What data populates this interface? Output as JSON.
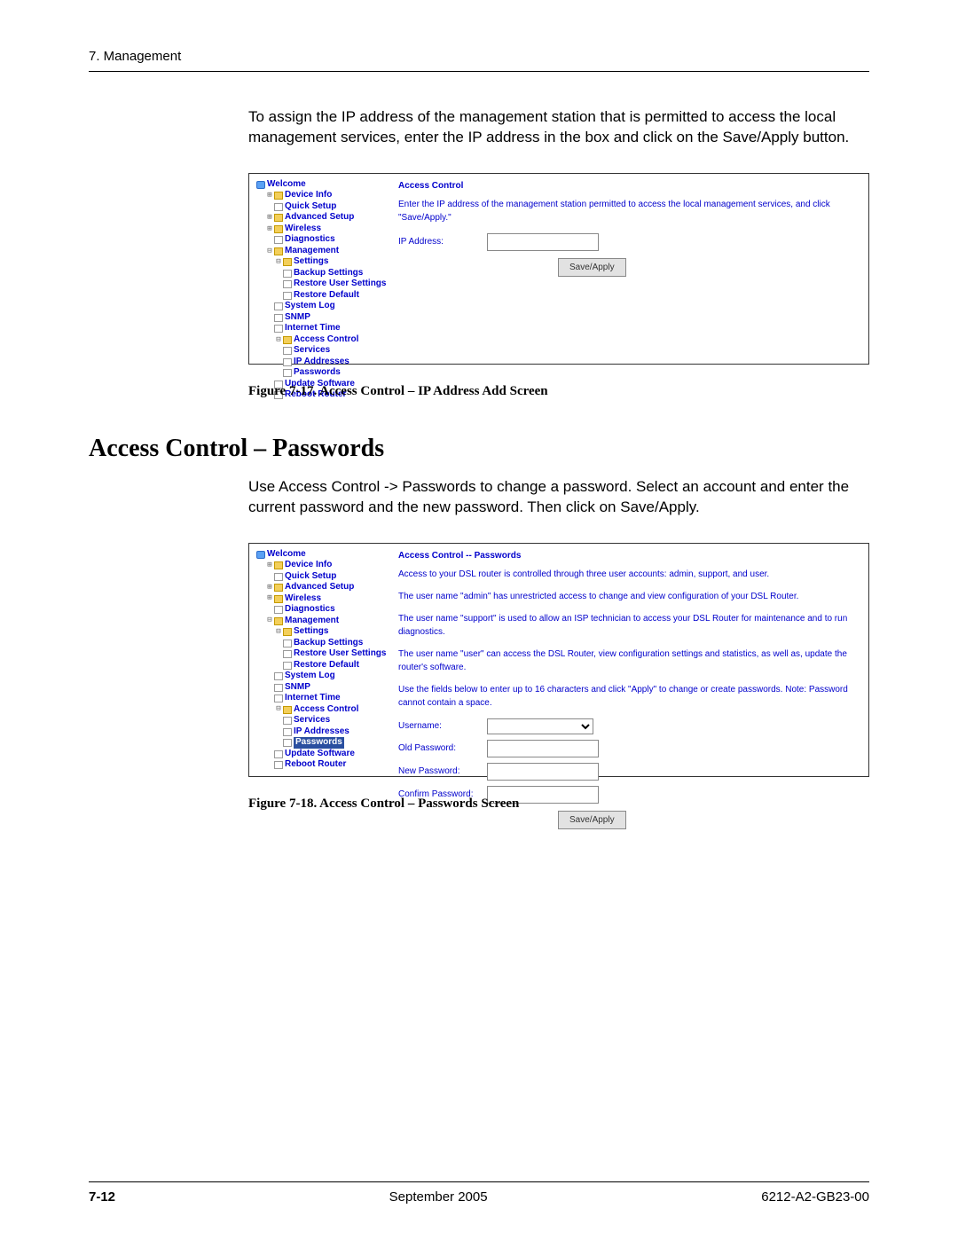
{
  "header": {
    "chapter": "7. Management"
  },
  "intro1": "To assign the IP address of the management station that is permitted to access the local management services, enter the IP address in the box and click on the Save/Apply button.",
  "fig17": {
    "nav": {
      "welcome": "Welcome",
      "device_info": "Device Info",
      "quick_setup": "Quick Setup",
      "advanced_setup": "Advanced Setup",
      "wireless": "Wireless",
      "diagnostics": "Diagnostics",
      "management": "Management",
      "settings": "Settings",
      "backup_settings": "Backup Settings",
      "restore_user": "Restore User Settings",
      "restore_default": "Restore Default",
      "system_log": "System Log",
      "snmp": "SNMP",
      "internet_time": "Internet Time",
      "access_control": "Access Control",
      "services": "Services",
      "ip_addresses": "IP Addresses",
      "passwords": "Passwords",
      "update_software": "Update Software",
      "reboot_router": "Reboot Router"
    },
    "content": {
      "title": "Access Control",
      "text": "Enter the IP address of the management station permitted to access the local management services, and click \"Save/Apply.\"",
      "ip_label": "IP Address:",
      "save": "Save/Apply"
    },
    "caption": "Figure 7-17.   Access Control – IP Address Add Screen"
  },
  "section2": {
    "heading": "Access Control – Passwords",
    "intro": "Use Access Control -> Passwords to change a password. Select an account and enter the current password and the new password. Then click on Save/Apply."
  },
  "fig18": {
    "nav": {
      "welcome": "Welcome",
      "device_info": "Device Info",
      "quick_setup": "Quick Setup",
      "advanced_setup": "Advanced Setup",
      "wireless": "Wireless",
      "diagnostics": "Diagnostics",
      "management": "Management",
      "settings": "Settings",
      "backup_settings": "Backup Settings",
      "restore_user": "Restore User Settings",
      "restore_default": "Restore Default",
      "system_log": "System Log",
      "snmp": "SNMP",
      "internet_time": "Internet Time",
      "access_control": "Access Control",
      "services": "Services",
      "ip_addresses": "IP Addresses",
      "passwords": "Passwords",
      "update_software": "Update Software",
      "reboot_router": "Reboot Router"
    },
    "content": {
      "title": "Access Control -- Passwords",
      "p1": "Access to your DSL router is controlled through three user accounts: admin, support, and user.",
      "p2": "The user name \"admin\" has unrestricted access to change and view configuration of your DSL Router.",
      "p3": "The user name \"support\" is used to allow an ISP technician to access your DSL Router for maintenance and to run diagnostics.",
      "p4": "The user name \"user\" can access the DSL Router, view configuration settings and statistics, as well as, update the router's software.",
      "p5": "Use the fields below to enter up to 16 characters and click \"Apply\" to change or create passwords. Note: Password cannot contain a space.",
      "username": "Username:",
      "oldpw": "Old Password:",
      "newpw": "New Password:",
      "confirmpw": "Confirm Password:",
      "save": "Save/Apply"
    },
    "caption": "Figure 7-18.   Access Control – Passwords Screen"
  },
  "footer": {
    "page": "7-12",
    "date": "September 2005",
    "docid": "6212-A2-GB23-00"
  }
}
